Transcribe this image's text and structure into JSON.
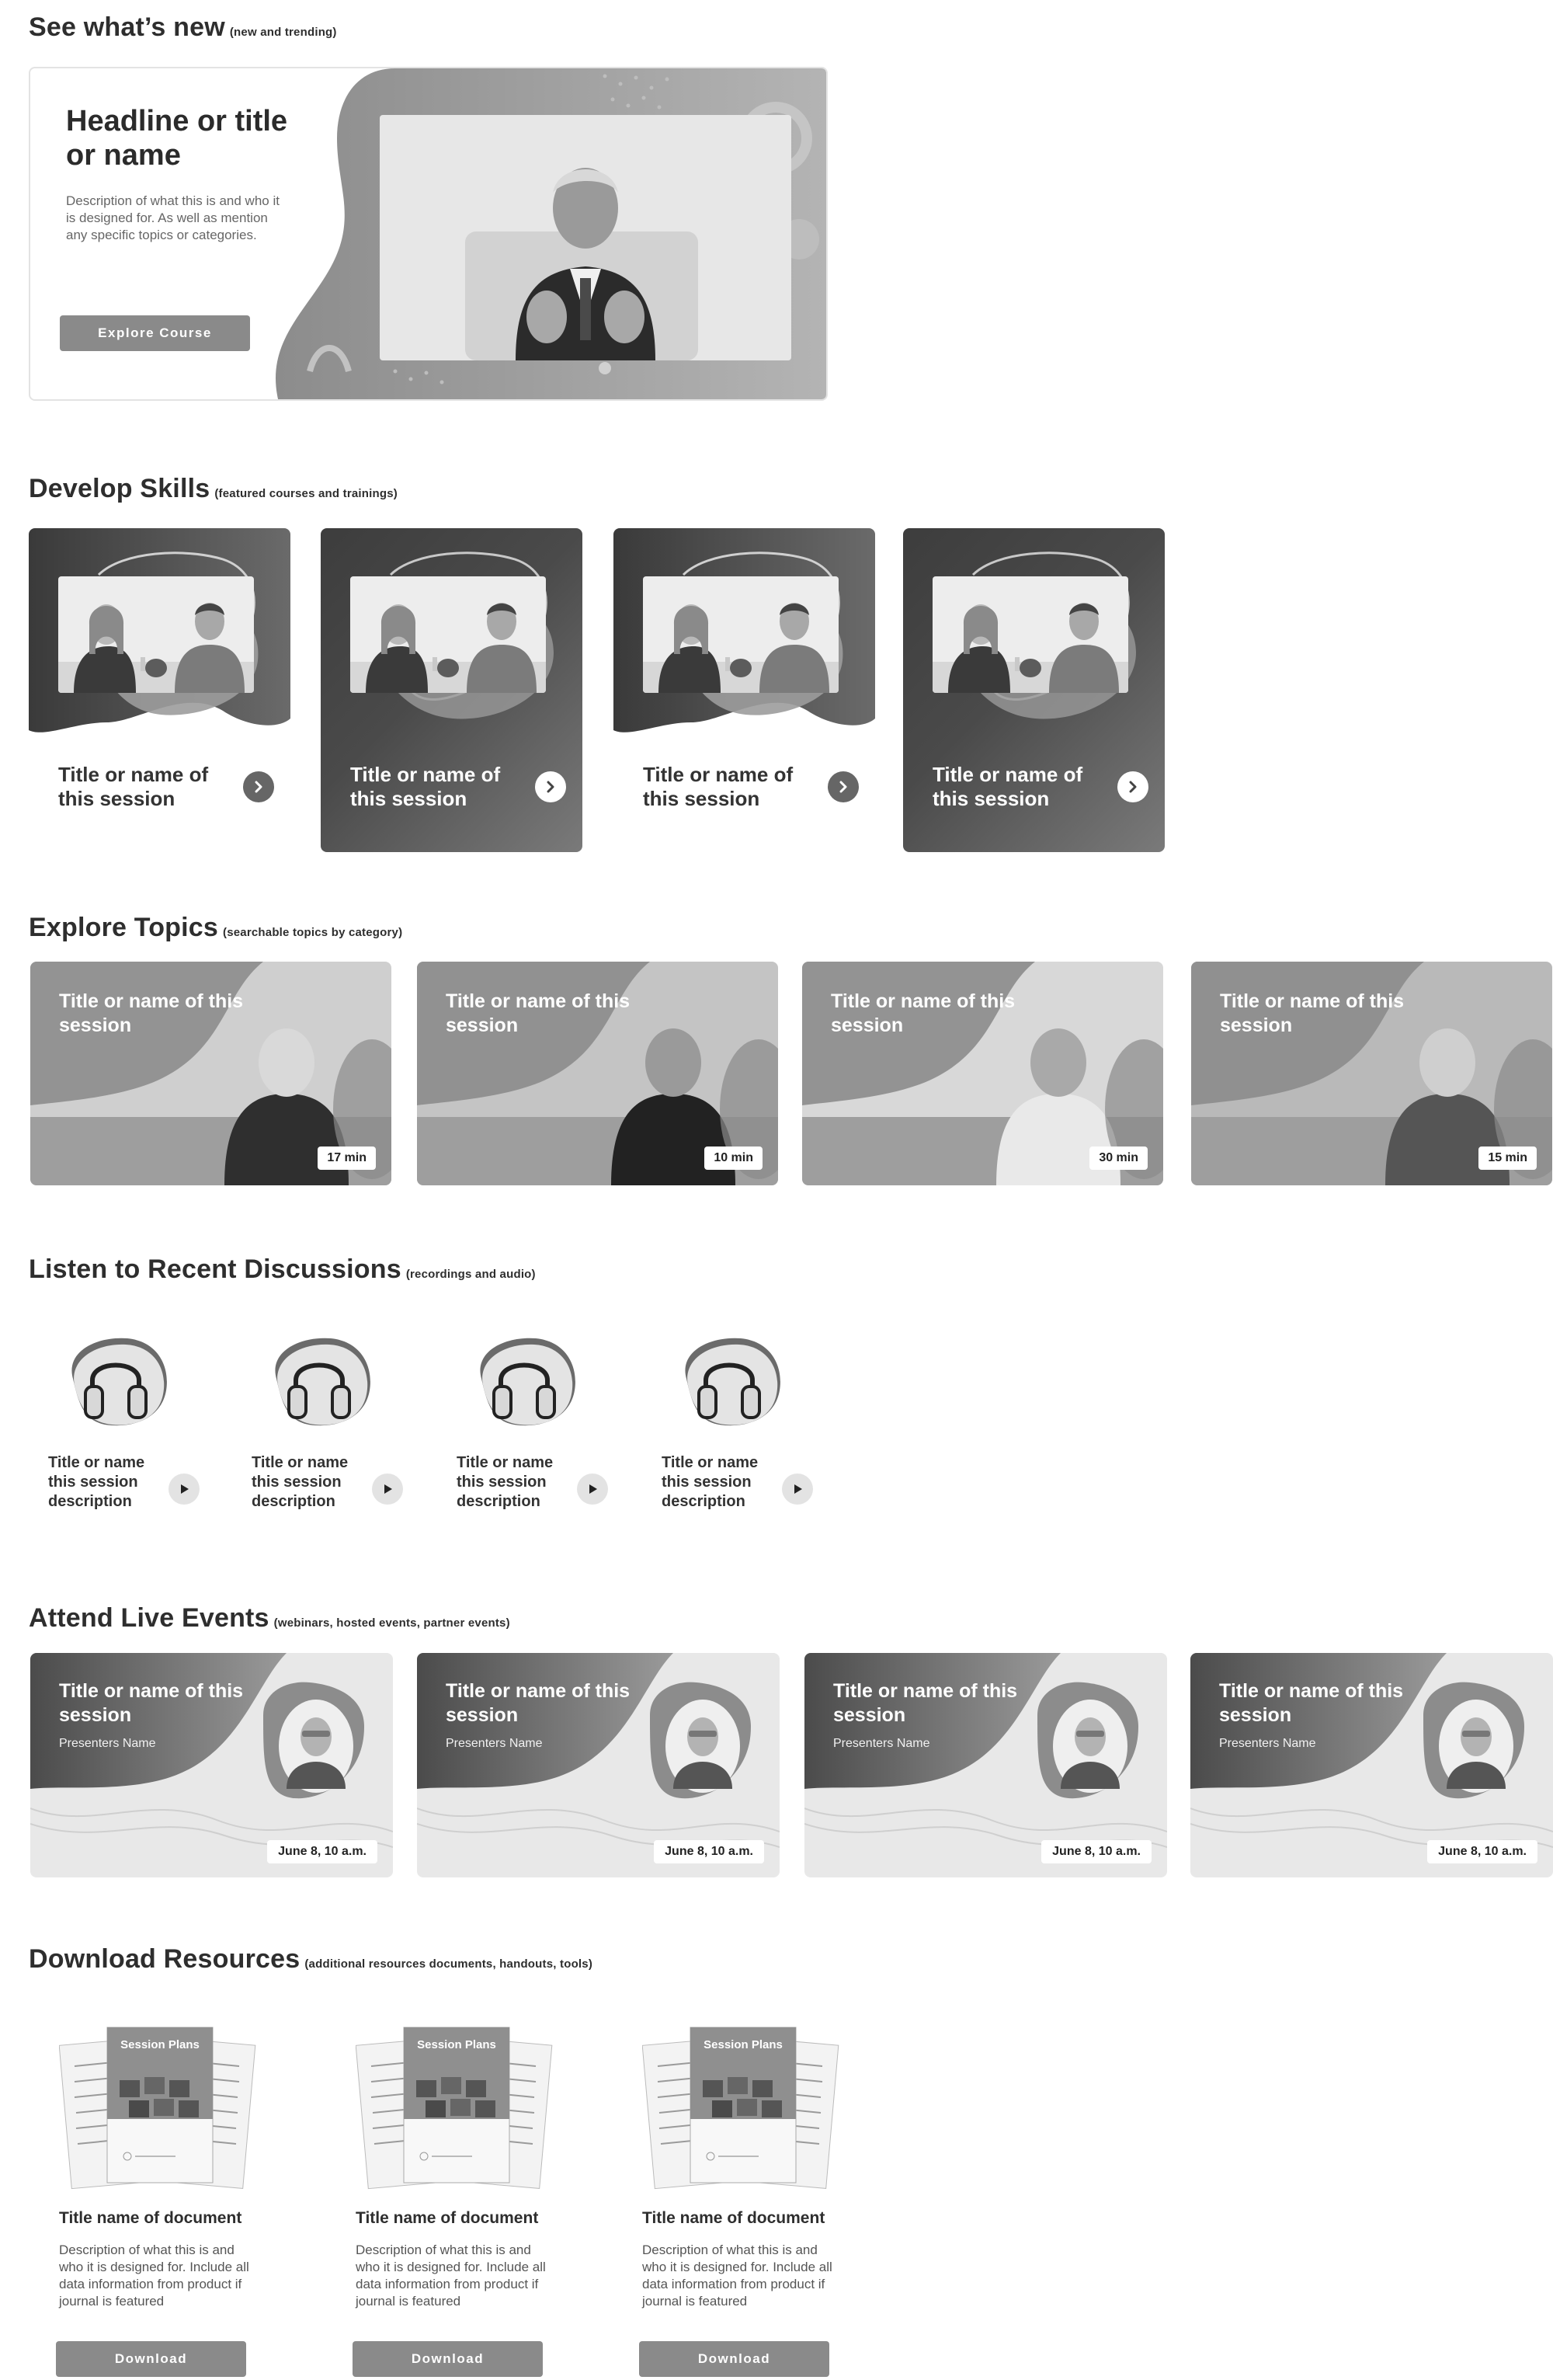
{
  "sections": {
    "whats_new": {
      "title": "See what’s new",
      "subtitle": "(new and trending)"
    },
    "develop": {
      "title": "Develop Skills",
      "subtitle": "(featured courses and trainings)"
    },
    "topics": {
      "title": "Explore Topics",
      "subtitle": "(searchable topics by category)"
    },
    "listen": {
      "title": "Listen to Recent Discussions",
      "subtitle": "(recordings and audio)"
    },
    "events": {
      "title": "Attend Live Events",
      "subtitle": "(webinars, hosted events, partner events)"
    },
    "resources": {
      "title": "Download Resources",
      "subtitle": "(additional resources documents, handouts, tools)"
    }
  },
  "hero": {
    "headline": "Headline or title or name",
    "description": "Description of what this is and who it is designed for. As well as mention any specific topics or categories.",
    "button_label": "Explore Course"
  },
  "skills": [
    {
      "title": "Title or name of this session",
      "style": "light"
    },
    {
      "title": "Title or name of this session",
      "style": "dark"
    },
    {
      "title": "Title or name of this session",
      "style": "light"
    },
    {
      "title": "Title or name of this session",
      "style": "dark"
    }
  ],
  "topics": [
    {
      "title": "Title or name of this session",
      "duration": "17 min"
    },
    {
      "title": "Title or name of this session",
      "duration": "10 min"
    },
    {
      "title": "Title or name of this session",
      "duration": "30 min"
    },
    {
      "title": "Title or name of this session",
      "duration": "15 min"
    }
  ],
  "audio": [
    {
      "title": "Title or name this session description",
      "icon": "headphones-icon"
    },
    {
      "title": "Title or name this session description",
      "icon": "headphones-icon"
    },
    {
      "title": "Title or name this session description",
      "icon": "headphones-icon"
    },
    {
      "title": "Title or name this session description",
      "icon": "headphones-icon"
    }
  ],
  "events": [
    {
      "title": "Title or name of this session",
      "presenter": "Presenters Name",
      "date": "June 8, 10 a.m."
    },
    {
      "title": "Title or name of this session",
      "presenter": "Presenters Name",
      "date": "June 8, 10 a.m."
    },
    {
      "title": "Title or name of this session",
      "presenter": "Presenters Name",
      "date": "June 8, 10 a.m."
    },
    {
      "title": "Title or name of this session",
      "presenter": "Presenters Name",
      "date": "June 8, 10 a.m."
    }
  ],
  "documents": [
    {
      "cover_title": "Session Plans",
      "title": "Title name of document",
      "description": "Description of what this is and who it is designed for. Include all data information from product if journal is featured",
      "button_label": "Download"
    },
    {
      "cover_title": "Session Plans",
      "title": "Title name of document",
      "description": "Description of what this is and who it is designed for. Include all data information from product if journal is featured",
      "button_label": "Download"
    },
    {
      "cover_title": "Session Plans",
      "title": "Title name of document",
      "description": "Description of what this is and who it is designed for. Include all data information from product if journal is featured",
      "button_label": "Download"
    }
  ]
}
